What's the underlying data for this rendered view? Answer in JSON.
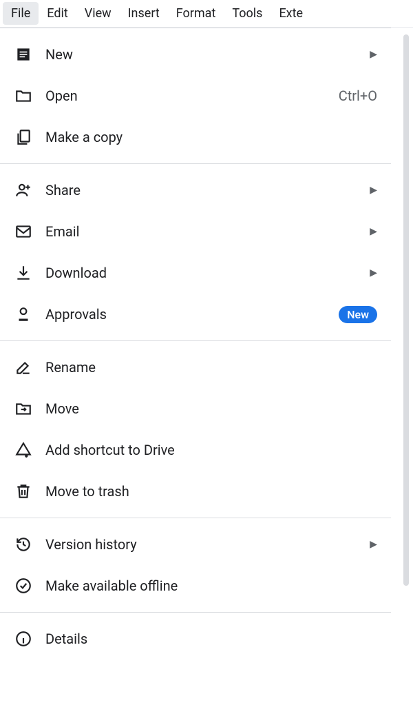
{
  "menubar": {
    "items": [
      {
        "label": "File"
      },
      {
        "label": "Edit"
      },
      {
        "label": "View"
      },
      {
        "label": "Insert"
      },
      {
        "label": "Format"
      },
      {
        "label": "Tools"
      },
      {
        "label": "Exte"
      }
    ]
  },
  "file_menu": {
    "group1": [
      {
        "label": "New",
        "has_submenu": true
      },
      {
        "label": "Open",
        "shortcut": "Ctrl+O"
      },
      {
        "label": "Make a copy"
      }
    ],
    "group2": [
      {
        "label": "Share",
        "has_submenu": true
      },
      {
        "label": "Email",
        "has_submenu": true
      },
      {
        "label": "Download",
        "has_submenu": true
      },
      {
        "label": "Approvals",
        "badge": "New"
      }
    ],
    "group3": [
      {
        "label": "Rename"
      },
      {
        "label": "Move"
      },
      {
        "label": "Add shortcut to Drive"
      },
      {
        "label": "Move to trash"
      }
    ],
    "group4": [
      {
        "label": "Version history",
        "has_submenu": true
      },
      {
        "label": "Make available offline"
      }
    ],
    "group5": [
      {
        "label": "Details"
      }
    ]
  }
}
